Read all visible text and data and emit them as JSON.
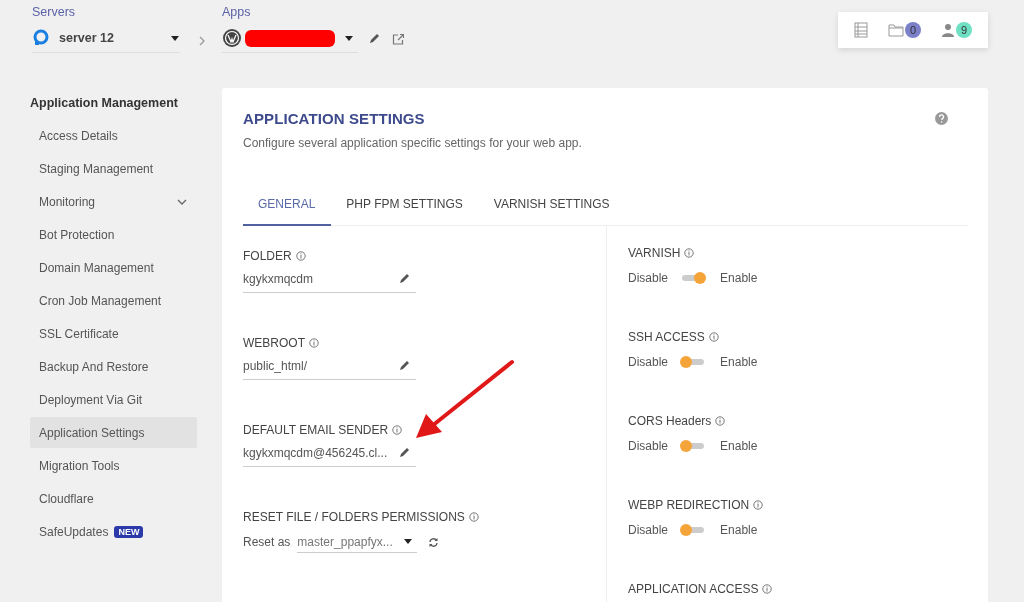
{
  "header": {
    "servers": {
      "label": "Servers",
      "value": "server 12"
    },
    "apps": {
      "label": "Apps",
      "redacted": true
    },
    "counters": [
      {
        "kind": "list"
      },
      {
        "kind": "folder",
        "count": "0",
        "color": "#7b80c8"
      },
      {
        "kind": "user",
        "count": "9",
        "color": "#6fe0c4"
      }
    ]
  },
  "sidebar": {
    "title": "Application Management",
    "items": [
      {
        "label": "Access Details",
        "selected": false
      },
      {
        "label": "Staging Management",
        "selected": false
      },
      {
        "label": "Monitoring",
        "selected": false,
        "expandable": true
      },
      {
        "label": "Bot Protection",
        "selected": false
      },
      {
        "label": "Domain Management",
        "selected": false
      },
      {
        "label": "Cron Job Management",
        "selected": false
      },
      {
        "label": "SSL Certificate",
        "selected": false
      },
      {
        "label": "Backup And Restore",
        "selected": false
      },
      {
        "label": "Deployment Via Git",
        "selected": false
      },
      {
        "label": "Application Settings",
        "selected": true
      },
      {
        "label": "Migration Tools",
        "selected": false
      },
      {
        "label": "Cloudflare",
        "selected": false
      },
      {
        "label": "SafeUpdates",
        "selected": false,
        "badge": "NEW"
      }
    ]
  },
  "panel": {
    "title": "APPLICATION SETTINGS",
    "description": "Configure several application specific settings for your web app.",
    "tabs": [
      {
        "label": "GENERAL",
        "selected": true
      },
      {
        "label": "PHP FPM SETTINGS",
        "selected": false
      },
      {
        "label": "VARNISH SETTINGS",
        "selected": false
      }
    ],
    "left": [
      {
        "kind": "text",
        "label": "FOLDER",
        "value": "kgykxmqcdm"
      },
      {
        "kind": "text",
        "label": "WEBROOT",
        "value": "public_html/"
      },
      {
        "kind": "text",
        "label": "DEFAULT EMAIL SENDER",
        "value": "kgykxmqcdm@456245.cl..."
      },
      {
        "kind": "select",
        "label": "RESET FILE / FOLDERS PERMISSIONS",
        "prefix": "Reset as",
        "value": "master_ppapfyx..."
      }
    ],
    "right": [
      {
        "kind": "toggle",
        "label": "VARNISH",
        "off_label": "Disable",
        "on_label": "Enable",
        "on": true
      },
      {
        "kind": "toggle",
        "label": "SSH ACCESS",
        "off_label": "Disable",
        "on_label": "Enable",
        "on": false
      },
      {
        "kind": "toggle",
        "label": "CORS Headers",
        "off_label": "Disable",
        "on_label": "Enable",
        "on": false
      },
      {
        "kind": "toggle",
        "label": "WEBP REDIRECTION",
        "off_label": "Disable",
        "on_label": "Enable",
        "on": false
      },
      {
        "kind": "heading",
        "label": "APPLICATION ACCESS"
      }
    ]
  },
  "annotation": {
    "kind": "arrow"
  }
}
